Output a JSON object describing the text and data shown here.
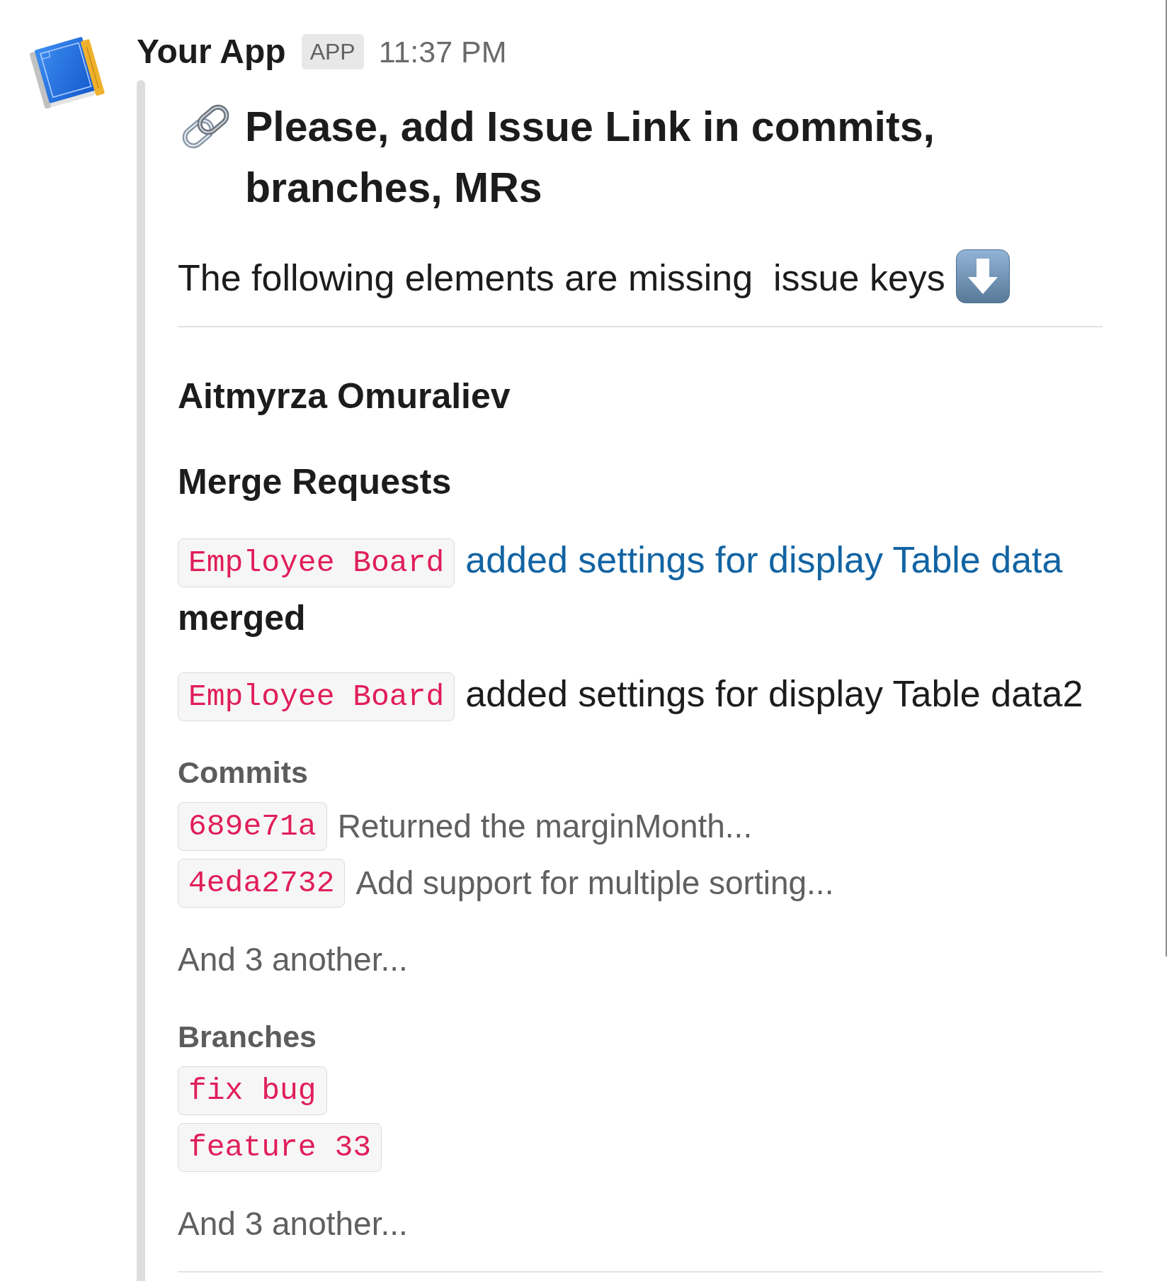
{
  "message": {
    "sender": "Your App",
    "badge": "APP",
    "time": "11:37 PM"
  },
  "attachment": {
    "title": "Please, add Issue Link in commits, branches, MRs",
    "intro": "The following elements are missing  issue keys",
    "authors": [
      {
        "name": "Aitmyrza Omuraliev",
        "merge_requests_heading": "Merge Requests",
        "merge_requests": [
          {
            "ref": "Employee Board",
            "title": "added settings for display Table data",
            "linked": true,
            "status": "merged"
          },
          {
            "ref": "Employee Board",
            "title": "added settings for display Table data2",
            "linked": false
          }
        ],
        "sections": [
          {
            "heading": "Commits",
            "items": [
              {
                "ref": "689e71a",
                "text": "Returned the marginMonth..."
              },
              {
                "ref": "4eda2732",
                "text": "Add support for multiple sorting..."
              }
            ],
            "more": "And 3 another..."
          },
          {
            "heading": "Branches",
            "items": [
              {
                "ref": "fix bug"
              },
              {
                "ref": "feature 33"
              }
            ],
            "more": "And 3 another..."
          }
        ]
      }
    ]
  }
}
